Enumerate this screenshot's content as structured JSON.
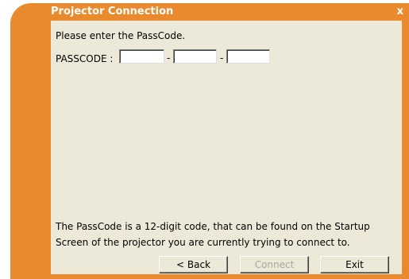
{
  "window": {
    "title": "Projector Connection",
    "close_label": "x",
    "accent_color": "#e98a2e",
    "panel_color": "#ece9d8"
  },
  "form": {
    "prompt": "Please enter the PassCode.",
    "passcode_label": "PASSCODE :",
    "separator": "-",
    "fields": [
      {
        "value": "",
        "placeholder": ""
      },
      {
        "value": "",
        "placeholder": ""
      },
      {
        "value": "",
        "placeholder": ""
      }
    ]
  },
  "info": {
    "line1": "The PassCode is a 12-digit code, that can be found on the Startup",
    "line2": "Screen of the projector you are currently trying to connect to."
  },
  "buttons": {
    "back": {
      "label": "< Back",
      "enabled": true
    },
    "connect": {
      "label": "Connect",
      "enabled": false
    },
    "exit": {
      "label": "Exit",
      "enabled": true
    }
  }
}
